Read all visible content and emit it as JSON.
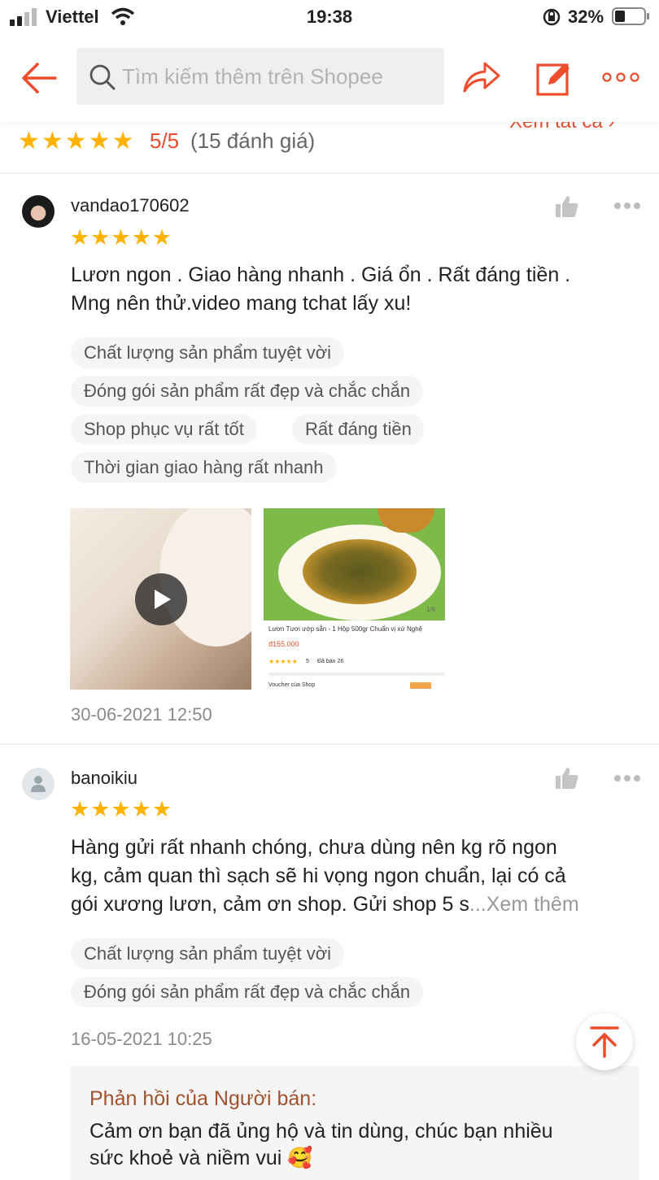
{
  "status_bar": {
    "carrier": "Viettel",
    "time": "19:38",
    "battery": "32%"
  },
  "nav": {
    "search_placeholder": "Tìm kiếm thêm trên Shopee"
  },
  "summary": {
    "stars": 5,
    "score": "5/5",
    "count": "(15 đánh giá)",
    "see_all": "Xem tất cả"
  },
  "reviews": [
    {
      "user": "vandao170602",
      "stars": 5,
      "text_line1": "Lươn ngon . Giao hàng nhanh . Giá ổn . Rất đáng tiền .",
      "text_line2": "Mng nên thử.video mang tchat lấy xu!",
      "tags": [
        "Chất lượng sản phẩm tuyệt vời",
        "Đóng gói sản phẩm rất đẹp và chắc chắn",
        "Shop phục vụ rất tốt",
        "Rất đáng tiền",
        "Thời gian giao hàng rất nhanh"
      ],
      "photo": {
        "title": "Lươn Tươi ướp sẵn - 1 Hộp 500gr Chuẩn vị xứ Nghệ",
        "price": "đ155.000",
        "sold": "Đã bán 26",
        "rating": "5",
        "page": "1/6",
        "voucher": "Voucher của Shop"
      },
      "date": "30-06-2021 12:50"
    },
    {
      "user": "banoikiu",
      "stars": 5,
      "text_line1": "Hàng gửi rất nhanh chóng, chưa dùng nên kg rõ ngon",
      "text_line2": "kg, cảm quan thì sạch sẽ hi vọng ngon chuẩn, lại có cả",
      "text_line3": "gói xương lươn, cảm ơn shop. Gửi shop 5 s",
      "ellipsis": "...",
      "more": "Xem thêm",
      "tags": [
        "Chất lượng sản phẩm tuyệt vời",
        "Đóng gói sản phẩm rất đẹp và chắc chắn"
      ],
      "date": "16-05-2021 10:25",
      "seller_reply": {
        "title": "Phản hồi của Người bán:",
        "line1": "Cảm ơn bạn đã ủng hộ và tin dùng, chúc bạn nhiều",
        "line2": "sức khoẻ và niềm vui 🥰"
      }
    }
  ],
  "colors": {
    "accent": "#ee4d2d",
    "star": "#ffb300",
    "reply_title": "#a0522d"
  },
  "icons": [
    "signal-icon",
    "wifi-icon",
    "lock-rotation-icon",
    "battery-icon",
    "back-arrow-icon",
    "search-icon",
    "share-icon",
    "edit-icon",
    "more-icon",
    "like-icon",
    "play-icon",
    "scroll-top-icon"
  ]
}
